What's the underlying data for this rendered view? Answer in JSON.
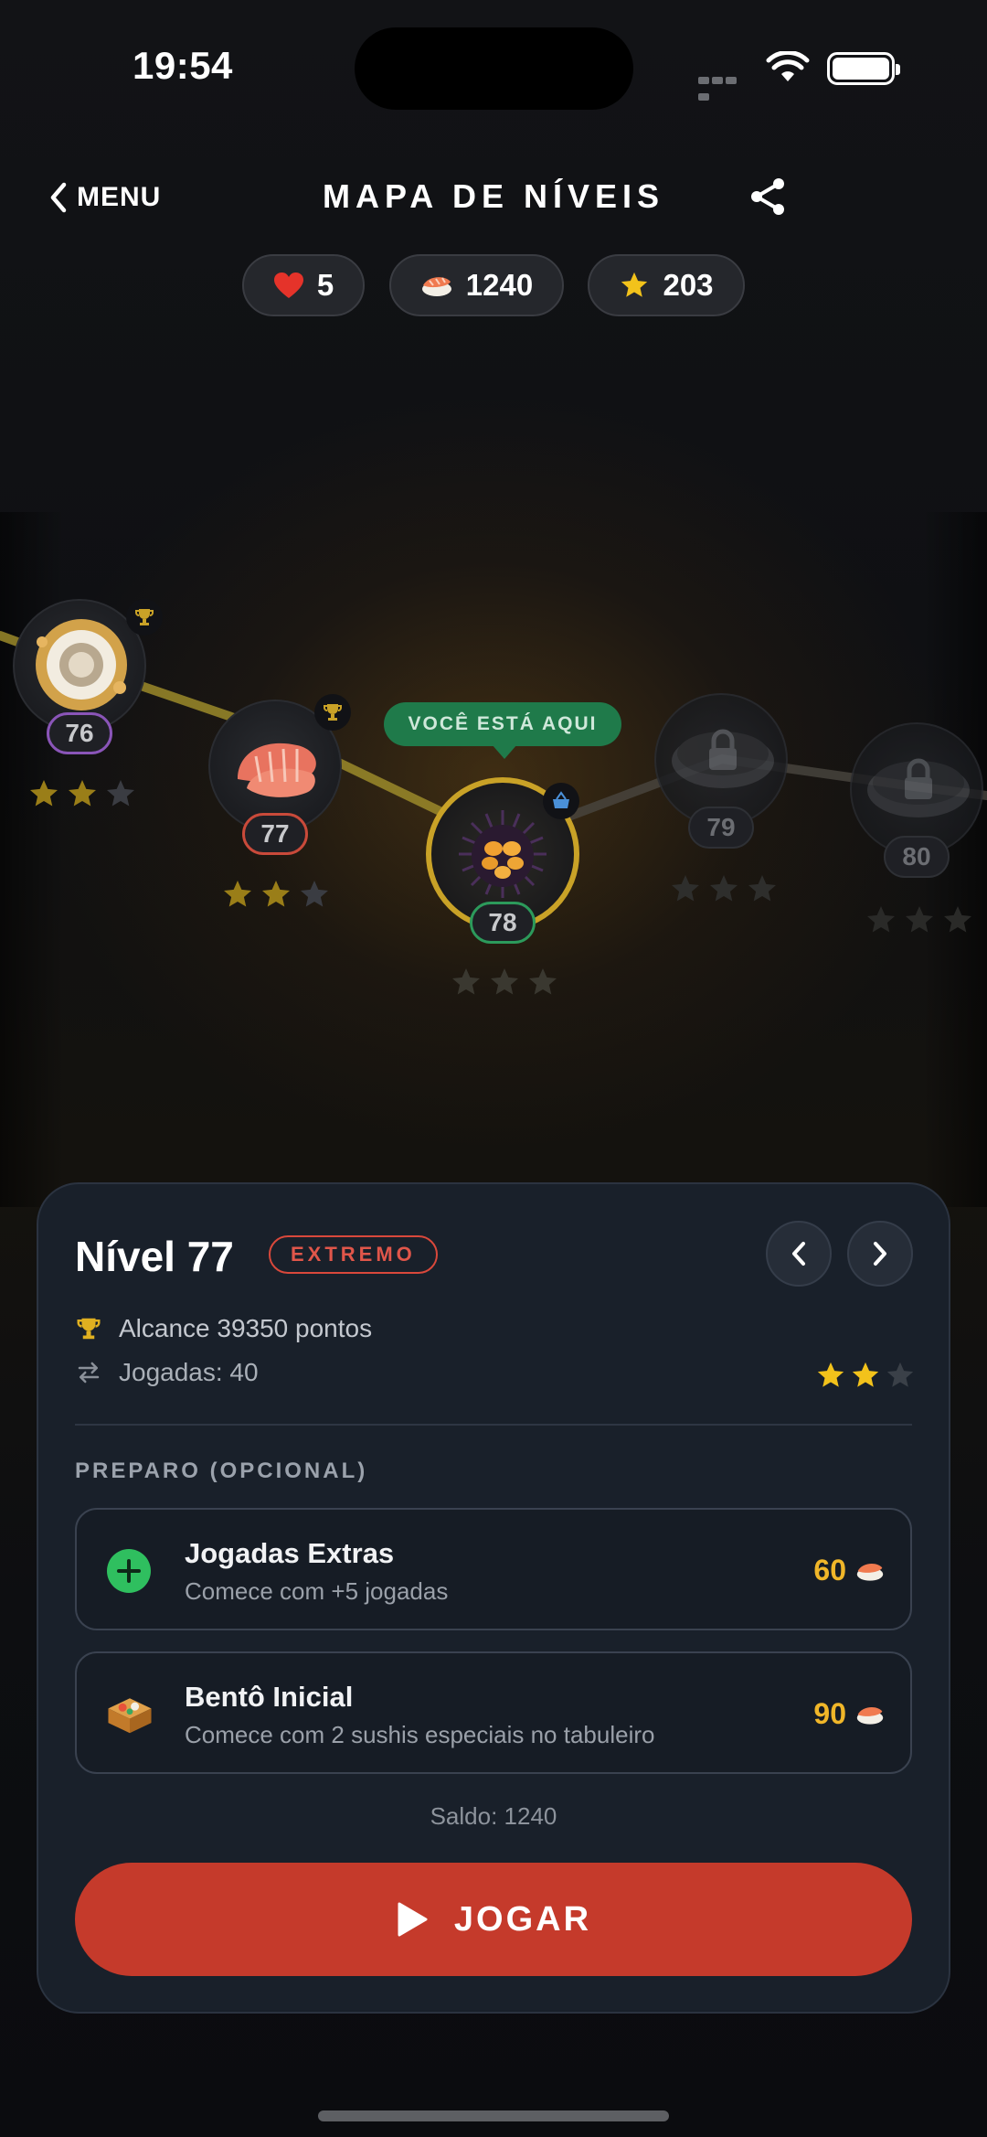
{
  "status_bar": {
    "time": "19:54"
  },
  "header": {
    "back_label": "MENU",
    "title": "MAPA DE NÍVEIS"
  },
  "resources": {
    "lives": "5",
    "coins": "1240",
    "stars": "203"
  },
  "map": {
    "here_label": "VOCÊ ESTÁ AQUI",
    "levels": [
      {
        "number": "76",
        "stars": 2,
        "state": "completed",
        "food": "sushi-roll",
        "badge": "trophy-icon"
      },
      {
        "number": "77",
        "stars": 2,
        "state": "completed",
        "food": "shrimp",
        "badge": "trophy-icon"
      },
      {
        "number": "78",
        "stars": 0,
        "state": "current",
        "food": "sea-urchin",
        "badge": "basket-icon"
      },
      {
        "number": "79",
        "stars": 0,
        "state": "locked",
        "food": "lock-icon"
      },
      {
        "number": "80",
        "stars": 0,
        "state": "locked",
        "food": "lock-icon"
      }
    ]
  },
  "panel": {
    "level_title": "Nível 77",
    "difficulty": "EXTREMO",
    "goal": "Alcance 39350 pontos",
    "moves": "Jogadas: 40",
    "stars": 2,
    "section_label": "PREPARO (OPCIONAL)",
    "boosts": [
      {
        "name": "Jogadas Extras",
        "desc": "Comece com +5 jogadas",
        "price": "60",
        "icon": "plus-icon"
      },
      {
        "name": "Bentô Inicial",
        "desc": "Comece com 2 sushis especiais no tabuleiro",
        "price": "90",
        "icon": "bento-icon"
      }
    ],
    "balance": "Saldo: 1240",
    "play_label": "JOGAR"
  },
  "colors": {
    "accent_red": "#c53a2b",
    "gold": "#f0b629",
    "here_green": "#1f7a4a",
    "star_gold": "#f2c21b",
    "star_empty": "#3a3c42"
  }
}
